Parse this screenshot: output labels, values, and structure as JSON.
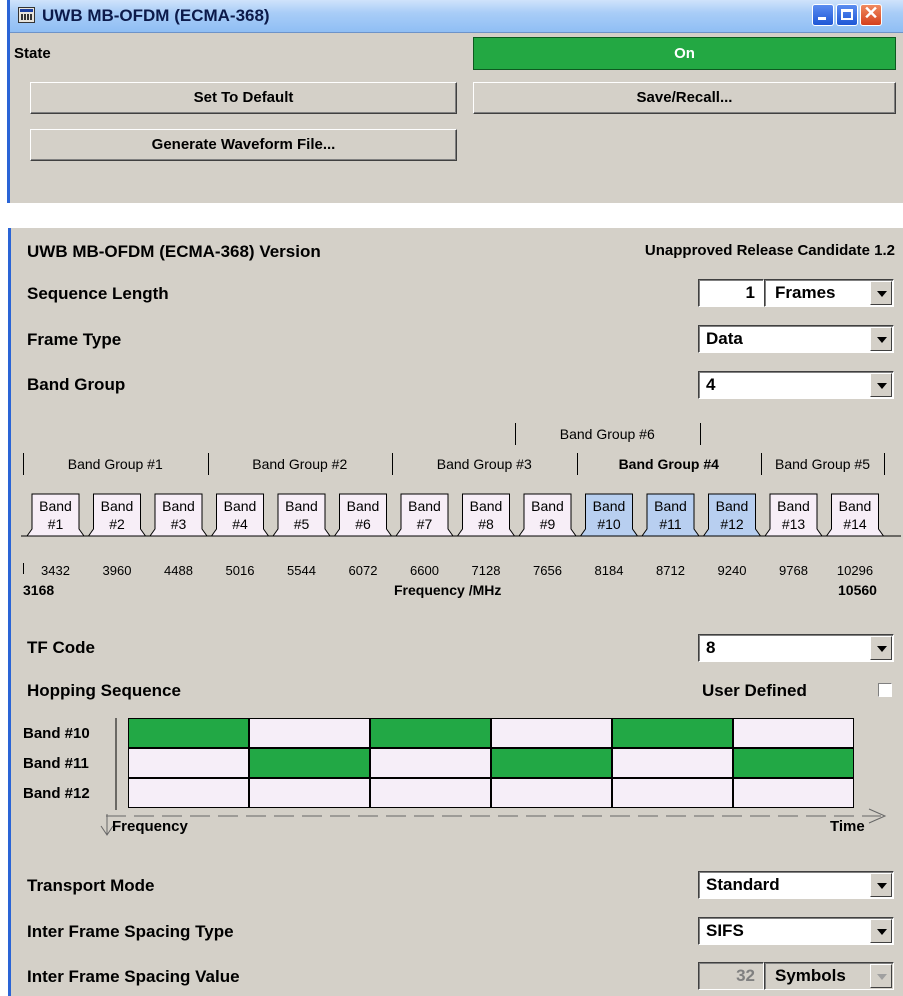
{
  "window": {
    "title": "UWB MB-OFDM (ECMA-368)",
    "state_label": "State",
    "state_value": "On",
    "set_default": "Set To Default",
    "save_recall": "Save/Recall...",
    "generate": "Generate Waveform File..."
  },
  "panel": {
    "version_label": "UWB MB-OFDM (ECMA-368) Version",
    "version_value": "Unapproved Release Candidate 1.2",
    "seq_len_label": "Sequence Length",
    "seq_len_value": "1",
    "seq_len_unit": "Frames",
    "frame_type_label": "Frame Type",
    "frame_type_value": "Data",
    "band_group_label": "Band Group",
    "band_group_value": "4",
    "tf_code_label": "TF Code",
    "tf_code_value": "8",
    "hopping_label": "Hopping Sequence",
    "user_defined_label": "User Defined",
    "user_defined_checked": false,
    "transport_label": "Transport Mode",
    "transport_value": "Standard",
    "ifs_type_label": "Inter Frame Spacing Type",
    "ifs_type_value": "SIFS",
    "ifs_value_label": "Inter Frame Spacing Value",
    "ifs_value": "32",
    "ifs_unit": "Symbols"
  },
  "band_plan": {
    "groups": [
      "Band Group #1",
      "Band Group #2",
      "Band Group #3",
      "Band Group #4",
      "Band Group #5",
      "Band Group #6"
    ],
    "selected_group": "Band Group #4",
    "bands": [
      "#1",
      "#2",
      "#3",
      "#4",
      "#5",
      "#6",
      "#7",
      "#8",
      "#9",
      "#10",
      "#11",
      "#12",
      "#13",
      "#14"
    ],
    "band_word": "Band",
    "selected_bands": [
      "#10",
      "#11",
      "#12"
    ],
    "freqs": [
      "3432",
      "3960",
      "4488",
      "5016",
      "5544",
      "6072",
      "6600",
      "7128",
      "7656",
      "8184",
      "8712",
      "9240",
      "9768",
      "10296"
    ],
    "freq_min": "3168",
    "freq_max": "10560",
    "axis_label": "Frequency /MHz",
    "colors": {
      "band_fill": "#f7eef7",
      "selected_fill": "#b8cff0"
    }
  },
  "hopping": {
    "rows": [
      "Band #10",
      "Band #11",
      "Band #12"
    ],
    "pattern": [
      0,
      1,
      0,
      1,
      0,
      1
    ],
    "freq_axis": "Frequency",
    "time_axis": "Time",
    "colors": {
      "active": "#22a845",
      "idle": "#f6eef8"
    }
  }
}
